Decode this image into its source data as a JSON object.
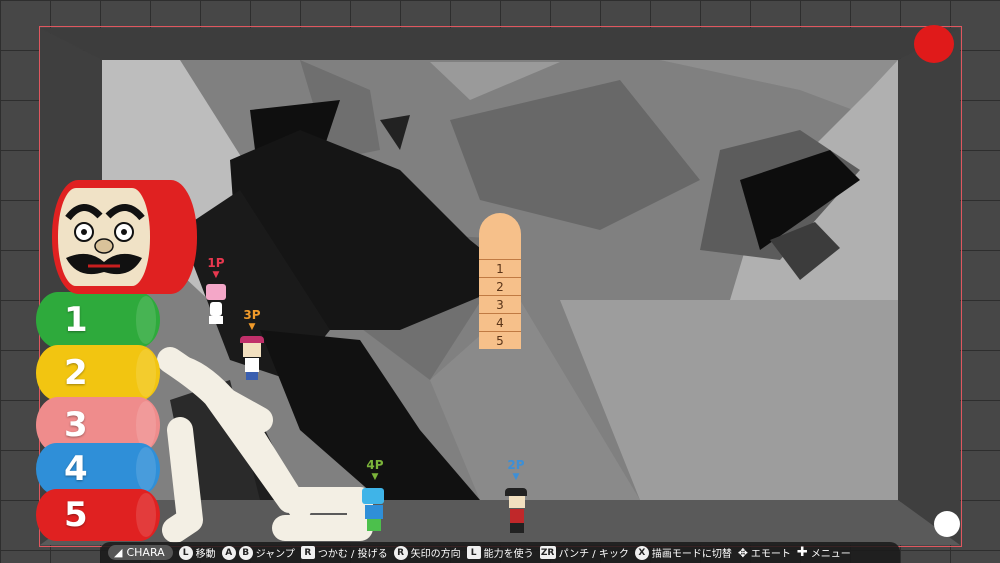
{
  "colors": {
    "frame": "#e0575f",
    "p1": "#e8384f",
    "p2": "#3d8fd6",
    "p3": "#f09a2a",
    "p4": "#7bb33a",
    "record_dot": "#e01a1a"
  },
  "players": {
    "p1": {
      "label": "1P"
    },
    "p2": {
      "label": "2P"
    },
    "p3": {
      "label": "3P"
    },
    "p4": {
      "label": "4P"
    }
  },
  "daruma": {
    "segments": [
      "1",
      "2",
      "3",
      "4",
      "5"
    ],
    "segment_colors": [
      "#2eaa3c",
      "#f2c511",
      "#ef8c8c",
      "#2f8fd8",
      "#e02121"
    ]
  },
  "board": {
    "rows": [
      "1",
      "2",
      "3",
      "4",
      "5"
    ]
  },
  "hud": {
    "chara": "CHARA",
    "items": [
      {
        "button": "L",
        "button_shape": "round",
        "label": "移動"
      },
      {
        "button": "A B",
        "button_shape": "pair",
        "label": "ジャンプ"
      },
      {
        "button": "R",
        "button_shape": "square",
        "label": "つかむ / 投げる"
      },
      {
        "button": "R",
        "button_shape": "round",
        "label": "矢印の方向"
      },
      {
        "button": "L",
        "button_shape": "square",
        "label": "能力を使う"
      },
      {
        "button": "ZR",
        "button_shape": "square",
        "label": "パンチ / キック"
      },
      {
        "button": "X",
        "button_shape": "round",
        "label": "描画モードに切替"
      },
      {
        "button": "dpad",
        "button_shape": "dpad",
        "label": "エモート"
      },
      {
        "button": "+",
        "button_shape": "plus",
        "label": "メニュー"
      }
    ]
  }
}
